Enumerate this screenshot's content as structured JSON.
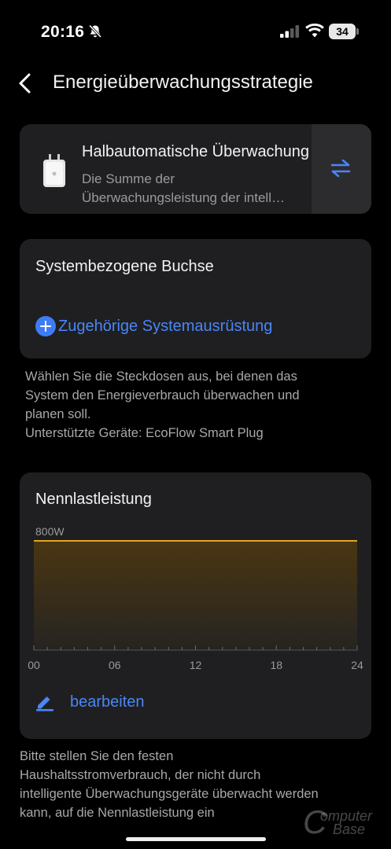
{
  "status_bar": {
    "time": "20:16",
    "battery": "34",
    "icons": [
      "bell-slash-icon",
      "signal-icon",
      "wifi-icon",
      "battery-icon"
    ]
  },
  "header": {
    "title": "Energieüberwachungsstrategie",
    "back_icon": "chevron-left-icon"
  },
  "strategy": {
    "title": "Halbautomatische Überwachung",
    "description_line1": "Die Summe der",
    "description_line2": "Überwachungsleistung der intell…",
    "icon": "smart-plug-icon",
    "switch_icon": "switch-arrows-icon"
  },
  "socket": {
    "title": "Systembezogene Buchse",
    "add_label": "Zugehörige Systemausrüstung"
  },
  "socket_note": {
    "line1": "Wählen Sie die Steckdosen aus, bei denen das",
    "line2": "System den Energieverbrauch überwachen und",
    "line3": "planen soll.",
    "line4": "Unterstützte Geräte: EcoFlow Smart Plug"
  },
  "load": {
    "title": "Nennlastleistung",
    "edit_label": "bearbeiten",
    "edit_icon": "pencil-icon"
  },
  "chart_data": {
    "type": "area",
    "title": "",
    "x": [
      0,
      24
    ],
    "y": [
      800,
      800
    ],
    "value_label": "800W",
    "xticks": [
      "00",
      "06",
      "12",
      "18",
      "24"
    ],
    "xlim": [
      0,
      24
    ],
    "ylim": [
      0,
      800
    ],
    "grid": false,
    "colors": {
      "line": "#e0a526",
      "fill_top": "#4a3612",
      "fill_bottom": "#262421"
    }
  },
  "footer_note": {
    "line1": "Bitte stellen Sie den festen",
    "line2": "Haushaltsstromverbrauch, der nicht durch",
    "line3": "intelligente Überwachungsgeräte überwacht werden",
    "line4": "kann, auf die Nennlastleistung ein"
  },
  "watermark": {
    "word1": "omputer",
    "word2": "Base"
  },
  "colors": {
    "accent": "#4a86f7",
    "card": "#1f1f21",
    "background": "#000000"
  }
}
